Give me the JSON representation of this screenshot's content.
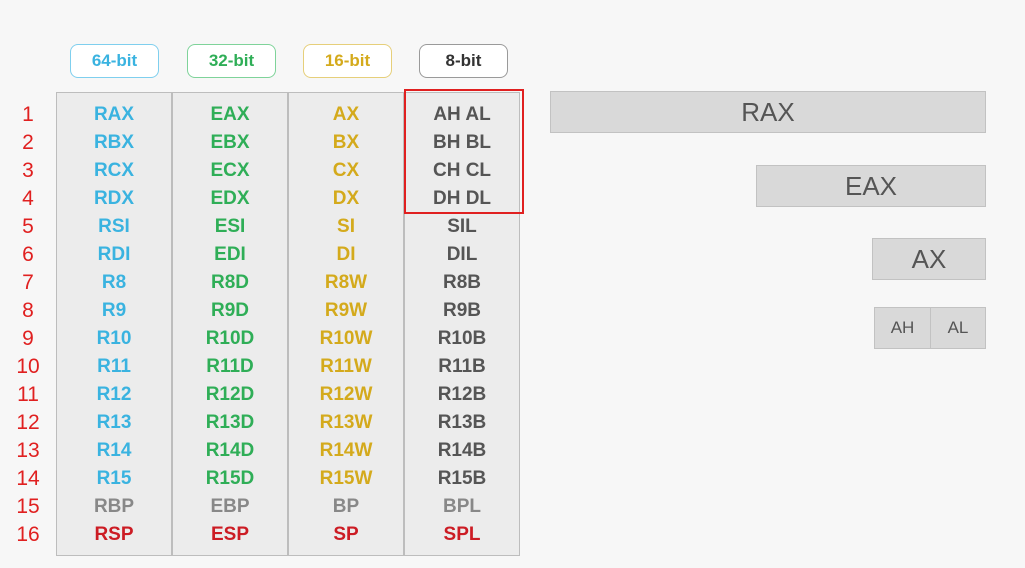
{
  "headers": [
    {
      "label": "64-bit",
      "color": "#3ab3e0"
    },
    {
      "label": "32-bit",
      "color": "#2fae57"
    },
    {
      "label": "16-bit",
      "color": "#d4aa1c"
    },
    {
      "label": "8-bit",
      "color": "#333333"
    }
  ],
  "rows": [
    {
      "num": "1",
      "r64": "RAX",
      "r32": "EAX",
      "r16": "AX",
      "r8": "AH AL"
    },
    {
      "num": "2",
      "r64": "RBX",
      "r32": "EBX",
      "r16": "BX",
      "r8": "BH BL"
    },
    {
      "num": "3",
      "r64": "RCX",
      "r32": "ECX",
      "r16": "CX",
      "r8": "CH CL"
    },
    {
      "num": "4",
      "r64": "RDX",
      "r32": "EDX",
      "r16": "DX",
      "r8": "DH DL"
    },
    {
      "num": "5",
      "r64": "RSI",
      "r32": "ESI",
      "r16": "SI",
      "r8": "SIL"
    },
    {
      "num": "6",
      "r64": "RDI",
      "r32": "EDI",
      "r16": "DI",
      "r8": "DIL"
    },
    {
      "num": "7",
      "r64": "R8",
      "r32": "R8D",
      "r16": "R8W",
      "r8": "R8B"
    },
    {
      "num": "8",
      "r64": "R9",
      "r32": "R9D",
      "r16": "R9W",
      "r8": "R9B"
    },
    {
      "num": "9",
      "r64": "R10",
      "r32": "R10D",
      "r16": "R10W",
      "r8": "R10B"
    },
    {
      "num": "10",
      "r64": "R11",
      "r32": "R11D",
      "r16": "R11W",
      "r8": "R11B"
    },
    {
      "num": "11",
      "r64": "R12",
      "r32": "R12D",
      "r16": "R12W",
      "r8": "R12B"
    },
    {
      "num": "12",
      "r64": "R13",
      "r32": "R13D",
      "r16": "R13W",
      "r8": "R13B"
    },
    {
      "num": "13",
      "r64": "R14",
      "r32": "R14D",
      "r16": "R14W",
      "r8": "R14B"
    },
    {
      "num": "14",
      "r64": "R15",
      "r32": "R15D",
      "r16": "R15W",
      "r8": "R15B"
    },
    {
      "num": "15",
      "r64": "RBP",
      "r32": "EBP",
      "r16": "BP",
      "r8": "BPL"
    },
    {
      "num": "16",
      "r64": "RSP",
      "r32": "ESP",
      "r16": "SP",
      "r8": "SPL"
    }
  ],
  "colors": {
    "row_number": "#e02020",
    "highlight_border": "#e02020",
    "c64": "#3ab3e0",
    "c32": "#2fae57",
    "c16": "#d4aa1c",
    "c8": "#555555",
    "base_pointer": "#888888",
    "stack_pointer": "#cc1c24"
  },
  "register_breakdown": {
    "rax": "RAX",
    "eax": "EAX",
    "ax": "AX",
    "ah": "AH",
    "al": "AL"
  }
}
